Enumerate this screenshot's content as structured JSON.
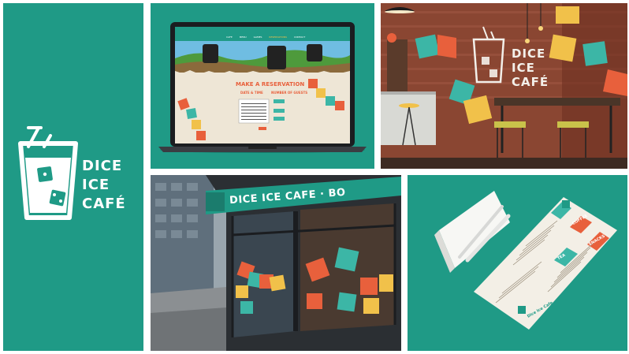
{
  "brand": {
    "logo_line1": "DICE",
    "logo_line2": "ICE",
    "logo_line3": "CAFÉ"
  },
  "laptop": {
    "reservation_title": "MAKE A RESERVATION",
    "date_label": "DATE & TIME",
    "guests_label": "NUMBER OF GUESTS",
    "nav_items": [
      "CAFE",
      "MENU",
      "GAMES",
      "RESERVATIONS",
      "CONTACT"
    ]
  },
  "interior": {
    "wall_line1": "DICE",
    "wall_line2": "ICE",
    "wall_line3": "CAFÉ"
  },
  "storefront": {
    "sign_text": "DICE ICE CAFE · BO"
  },
  "menu": {
    "sections": [
      "COFFEE",
      "TEA",
      "SNACKS"
    ],
    "footer": "Dice Ice Cafe"
  },
  "colors": {
    "brand_teal": "#1f9a86",
    "accent_orange": "#e8603c",
    "accent_yellow": "#f1c14a",
    "accent_teal_light": "#3cb6a6",
    "cream": "#f3efe6"
  }
}
